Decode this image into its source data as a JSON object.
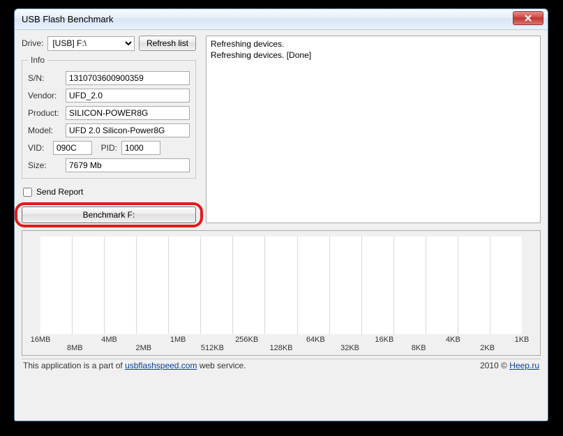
{
  "window": {
    "title": "USB Flash Benchmark"
  },
  "controls": {
    "drive_label": "Drive:",
    "drive_selected": "[USB] F:\\",
    "refresh_label": "Refresh list",
    "send_report_label": "Send Report",
    "send_report_checked": false,
    "benchmark_label": "Benchmark F:"
  },
  "info": {
    "legend": "Info",
    "sn_label": "S/N:",
    "sn": "1310703600900359",
    "vendor_label": "Vendor:",
    "vendor": "UFD_2.0",
    "product_label": "Product:",
    "product": "SILICON-POWER8G",
    "model_label": "Model:",
    "model": "UFD 2.0 Silicon-Power8G",
    "vid_label": "VID:",
    "vid": "090C",
    "pid_label": "PID:",
    "pid": "1000",
    "size_label": "Size:",
    "size": "7679 Mb"
  },
  "log": {
    "text": "Refreshing devices.\nRefreshing devices. [Done]"
  },
  "chart_data": {
    "type": "bar",
    "categories": [
      "16MB",
      "8MB",
      "4MB",
      "2MB",
      "1MB",
      "512KB",
      "256KB",
      "128KB",
      "64KB",
      "32KB",
      "16KB",
      "8KB",
      "4KB",
      "2KB",
      "1KB"
    ],
    "values": [],
    "title": "",
    "xlabel": "",
    "ylabel": "",
    "ylim": [
      0,
      0
    ]
  },
  "footer": {
    "prefix": "This application is a part of ",
    "link1_text": "usbflashspeed.com",
    "suffix": " web service.",
    "right_prefix": "2010 © ",
    "link2_text": "Heep.ru"
  }
}
